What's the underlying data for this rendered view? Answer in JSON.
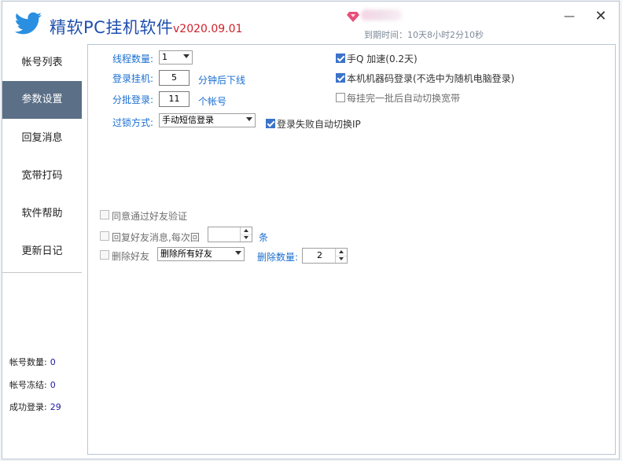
{
  "app": {
    "title": "精软PC挂机软件",
    "version": "v2020.09.01",
    "expire_text": "到期时间：10天8小时2分10秒",
    "minimize_label": "—",
    "close_label": "✕",
    "colors": {
      "title": "#1f4fae",
      "version": "#d0202a",
      "nav_active": "#5b6f87",
      "blue_label": "#1a6fd1"
    }
  },
  "sidebar": {
    "items": [
      {
        "label": "帐号列表"
      },
      {
        "label": "参数设置"
      },
      {
        "label": "回复消息"
      },
      {
        "label": "宽带打码"
      },
      {
        "label": "软件帮助"
      },
      {
        "label": "更新日记"
      }
    ],
    "active_index": 1,
    "stats": [
      {
        "label": "帐号数量:",
        "value": "0"
      },
      {
        "label": "帐号冻结:",
        "value": "0"
      },
      {
        "label": "成功登录:",
        "value": "29"
      }
    ]
  },
  "settings": {
    "thread_count": {
      "label": "线程数量:",
      "value": "1"
    },
    "login_hang": {
      "label": "登录挂机:",
      "value": "5",
      "suffix": "分钟后下线"
    },
    "batch_login": {
      "label": "分批登录:",
      "value": "11",
      "suffix": "个帐号"
    },
    "unlock_method": {
      "label": "过锁方式:",
      "value": "手动短信登录"
    },
    "mobile_q": {
      "label": "手Q 加速(0.2天)",
      "checked": true
    },
    "machine_code": {
      "label": "本机机器码登录(不选中为随机电脑登录)",
      "checked": true
    },
    "switch_broadband": {
      "label": "每挂完一批后自动切换宽带",
      "checked": false
    },
    "switch_ip": {
      "label": "登录失败自动切换IP",
      "checked": true
    },
    "accept_friend": {
      "label": "同意通过好友验证",
      "checked": false
    },
    "reply_friend": {
      "label": "回复好友消息,每次回",
      "value": "",
      "suffix": "条",
      "checked": false
    },
    "delete_friend": {
      "label": "删除好友",
      "checked": false,
      "mode": "删除所有好友",
      "count_label": "删除数量:",
      "count": "2"
    }
  }
}
